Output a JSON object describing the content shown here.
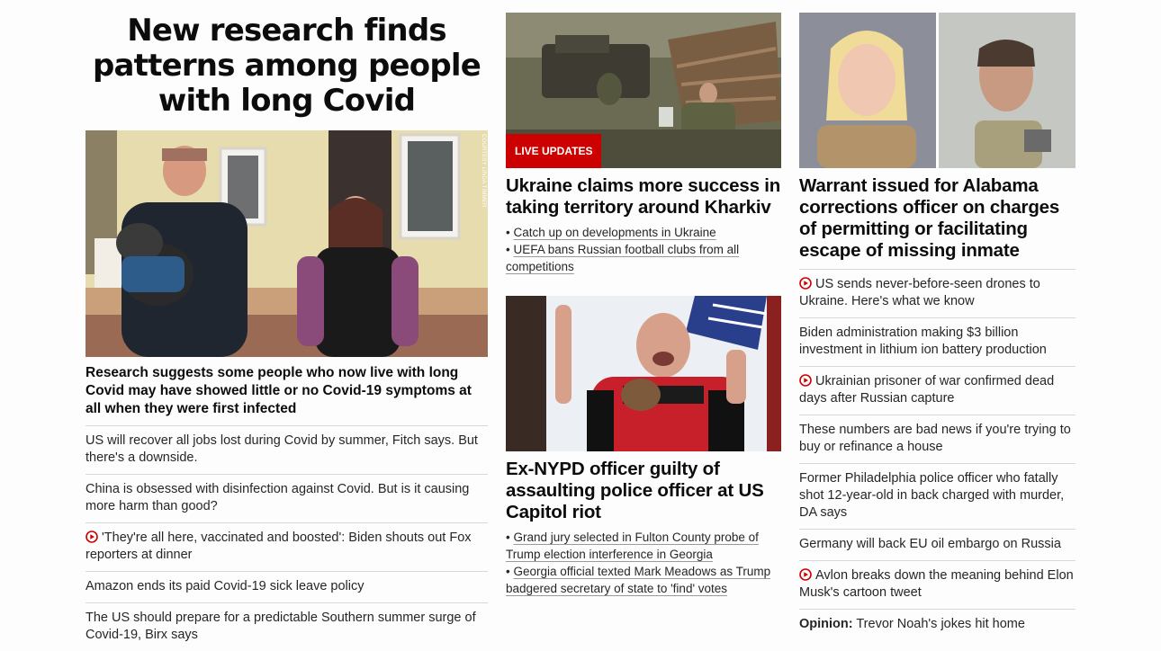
{
  "col1": {
    "headline": "New research finds patterns among people with long Covid",
    "photo_credit": "COURTESY LINDA TIMMER",
    "lead": "Research suggests some people who now live with long Covid may have showed little or no Covid-19 symptoms at all when they were first infected",
    "items": [
      {
        "text": "US will recover all jobs lost during Covid by summer, Fitch says. But there's a downside.",
        "video": false
      },
      {
        "text": "China is obsessed with disinfection against Covid. But is it causing more harm than good?",
        "video": false
      },
      {
        "text": "'They're all here, vaccinated and boosted': Biden shouts out Fox reporters at dinner",
        "video": true
      },
      {
        "text": "Amazon ends its paid Covid-19 sick leave policy",
        "video": false
      },
      {
        "text": "The US should prepare for a predictable Southern summer surge of Covid-19, Birx says",
        "video": false
      }
    ]
  },
  "col2": {
    "story1": {
      "badge": "LIVE UPDATES",
      "headline": "Ukraine claims more success in taking territory around Kharkiv",
      "bullets": [
        {
          "prefix": "• ",
          "text": "Catch up on developments in Ukraine"
        },
        {
          "prefix": "• ",
          "text": "UEFA bans Russian football clubs from all competitions"
        }
      ]
    },
    "story2": {
      "headline": "Ex-NYPD officer guilty of assaulting police officer at US Capitol riot",
      "bullets": [
        {
          "prefix": "• ",
          "text": "Grand jury selected in Fulton County probe of Trump election interference in Georgia"
        },
        {
          "prefix": "• ",
          "text": "Georgia official texted Mark Meadows as Trump badgered secretary of state to 'find' votes"
        }
      ]
    }
  },
  "col3": {
    "headline": "Warrant issued for Alabama corrections officer on charges of permitting or facilitating escape of missing inmate",
    "items": [
      {
        "text": "US sends never-before-seen drones to Ukraine. Here's what we know",
        "video": true
      },
      {
        "text": "Biden administration making $3 billion investment in lithium ion battery production",
        "video": false
      },
      {
        "text": "Ukrainian prisoner of war confirmed dead days after Russian capture",
        "video": true
      },
      {
        "text": "These numbers are bad news if you're trying to buy or refinance a house",
        "video": false
      },
      {
        "text": "Former Philadelphia police officer who fatally shot 12-year-old in back charged with murder, DA says",
        "video": false
      },
      {
        "text": "Germany will back EU oil embargo on Russia",
        "video": false
      },
      {
        "text": "Avlon breaks down the meaning behind Elon Musk's cartoon tweet",
        "video": true
      }
    ],
    "opinion": {
      "label": "Opinion:",
      "text": " Trevor Noah's jokes hit home"
    }
  },
  "colors": {
    "accent_red": "#cc0000",
    "text": "#0c0c0c",
    "divider": "#d8d8d8"
  }
}
